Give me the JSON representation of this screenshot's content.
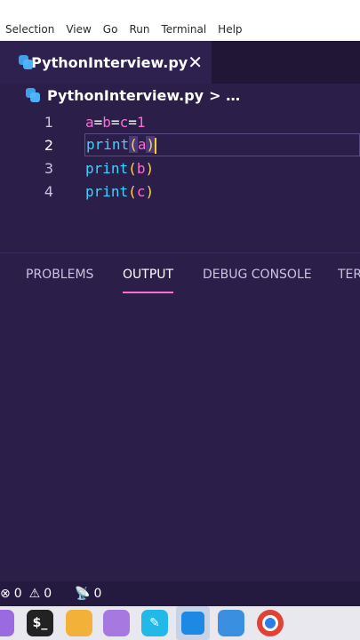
{
  "menu": {
    "items": [
      "Selection",
      "View",
      "Go",
      "Run",
      "Terminal",
      "Help"
    ]
  },
  "tab": {
    "filename": "PythonInterview.py",
    "close_glyph": "✕"
  },
  "breadcrumb": {
    "file": "PythonInterview.py",
    "separator": "> …"
  },
  "editor": {
    "lines": [
      {
        "num": "1"
      },
      {
        "num": "2"
      },
      {
        "num": "3"
      },
      {
        "num": "4"
      }
    ],
    "line1": {
      "a": "a",
      "eq1": "=",
      "b": "b",
      "eq2": "=",
      "c": "c",
      "eq3": "=",
      "val": "1"
    },
    "line2": {
      "fn": "print",
      "open": "(",
      "arg": "a",
      "close": ")"
    },
    "line3": {
      "fn": "print",
      "open": "(",
      "arg": "b",
      "close": ")"
    },
    "line4": {
      "fn": "print",
      "open": "(",
      "arg": "c",
      "close": ")"
    }
  },
  "panel": {
    "tabs": [
      "PROBLEMS",
      "OUTPUT",
      "DEBUG CONSOLE",
      "TER"
    ],
    "active": "OUTPUT"
  },
  "status": {
    "errors": "0",
    "warnings": "0",
    "ports": "0"
  },
  "colors": {
    "accent": "#ff6ad5",
    "background": "#2b1f4a",
    "keyword": "#40d2ff"
  }
}
